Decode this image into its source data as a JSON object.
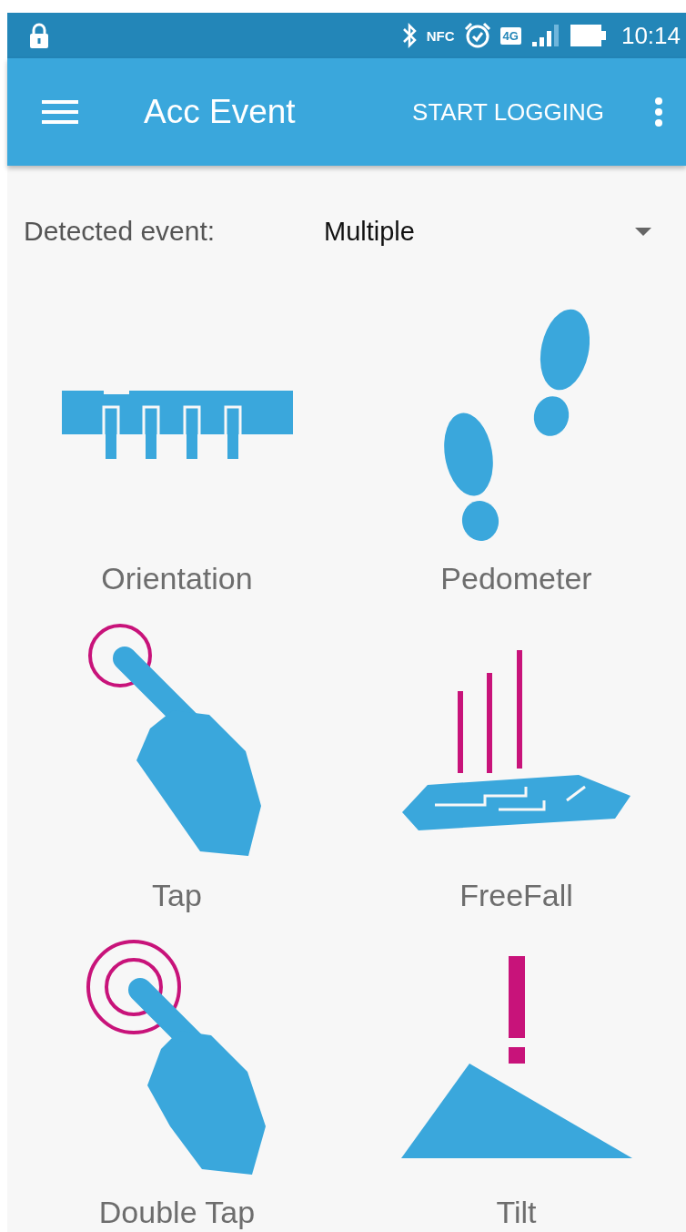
{
  "status_bar": {
    "nfc_label": "NFC",
    "network_type": "4G",
    "time": "10:14"
  },
  "app_bar": {
    "title": "Acc Event",
    "action": "START LOGGING"
  },
  "detected_event": {
    "label": "Detected event:",
    "value": "Multiple"
  },
  "events": [
    {
      "kind": "orientation",
      "label": "Orientation"
    },
    {
      "kind": "pedometer",
      "label": "Pedometer"
    },
    {
      "kind": "tap",
      "label": "Tap"
    },
    {
      "kind": "freefall",
      "label": "FreeFall"
    },
    {
      "kind": "double_tap",
      "label": "Double Tap"
    },
    {
      "kind": "tilt",
      "label": "Tilt"
    }
  ]
}
